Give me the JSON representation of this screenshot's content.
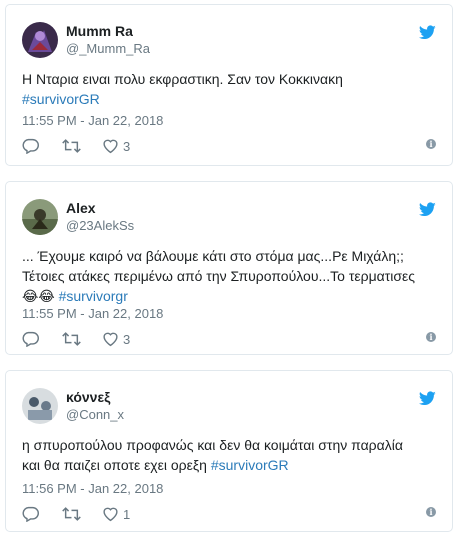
{
  "tweets": [
    {
      "name": "Mumm Ra",
      "handle": "@_Mumm_Ra",
      "text": "Η Νταρια ειναι πολυ εκφραστικη. Σαν τον Κοκκινακη",
      "hashtag": "#survivorGR",
      "date": "11:55 PM - Jan 22, 2018",
      "likes": "3"
    },
    {
      "name": "Alex",
      "handle": "@23AlekSs",
      "text_line1": "... Έχουμε καιρό να βάλουμε κάτι στο στόμα μας...Ρε Μιχάλη;;",
      "text_line2": "Τέτοιες ατάκες περιμένω από την Σπυροπούλου...Το τερματισες",
      "emoji": "😂😂",
      "hashtag": "#survivorgr",
      "date": "11:55 PM - Jan 22, 2018",
      "likes": "3"
    },
    {
      "name": "κόννεξ",
      "handle": "@Conn_x",
      "text_line1": "η σπυροπούλου προφανώς και δεν θα κοιμάται στην παραλία",
      "text_line2": "και θα παιζει οποτε εχει ορεξη",
      "hashtag": "#survivorGR",
      "date": "11:56 PM - Jan 22, 2018",
      "likes": "1"
    }
  ],
  "icons": {
    "bird": "twitter-bird-icon",
    "reply": "reply-icon",
    "retweet": "retweet-icon",
    "like": "heart-icon",
    "info": "info-icon"
  },
  "colors": {
    "accent": "#1da1f2",
    "link": "#2b7bb9",
    "muted": "#697882",
    "border": "#e1e8ed"
  }
}
